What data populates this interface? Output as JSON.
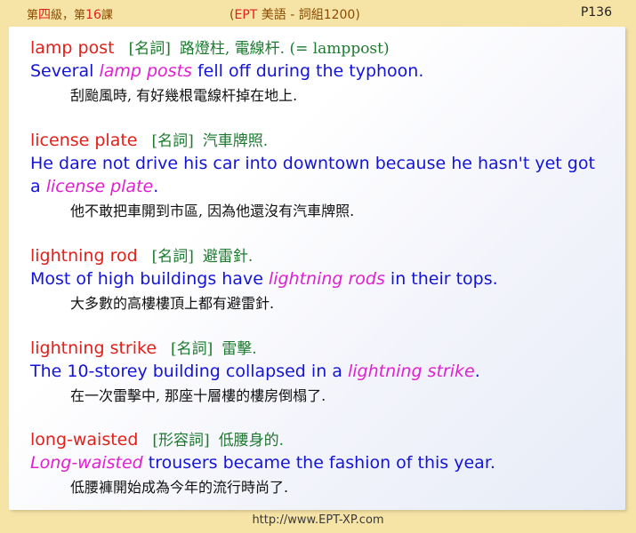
{
  "header": {
    "lesson_prefix": "第",
    "level_char": "四",
    "level_suffix": "級",
    "sep": "，",
    "lesson_pre": "第",
    "lesson_num": "16",
    "lesson_post": "課",
    "title_open": "(",
    "title_ept": "EPT",
    "title_rest": " 美語 - 詞組1200)",
    "page": "P136"
  },
  "entries": [
    {
      "term": "lamp post",
      "pos": "[名詞]",
      "definition": "路燈柱, 電線杆. (= lamppost)",
      "sentence_before": "Several ",
      "sentence_highlight": "lamp posts",
      "sentence_after": " fell off during the typhoon.",
      "translation": "刮颱風時, 有好幾根電線杆掉在地上."
    },
    {
      "term": "license plate",
      "pos": "[名詞]",
      "definition": "汽車牌照.",
      "sentence_before": "He dare not drive his car into downtown because he hasn't yet got a ",
      "sentence_highlight": "license plate",
      "sentence_after": ".",
      "translation": "他不敢把車開到市區, 因為他還沒有汽車牌照."
    },
    {
      "term": "lightning rod",
      "pos": "[名詞]",
      "definition": "避雷針.",
      "sentence_before": "Most of high buildings have ",
      "sentence_highlight": "lightning rods",
      "sentence_after": " in their tops.",
      "translation": "大多數的高樓樓頂上都有避雷針."
    },
    {
      "term": "lightning strike",
      "pos": "[名詞]",
      "definition": "雷擊.",
      "sentence_before": "The 10-storey building collapsed in a ",
      "sentence_highlight": "lightning strike",
      "sentence_after": ".",
      "translation": "在一次雷擊中, 那座十層樓的樓房倒榻了."
    },
    {
      "term": "long-waisted",
      "pos": "[形容詞]",
      "definition": "低腰身的.",
      "sentence_before": "",
      "sentence_highlight": "Long-waisted",
      "sentence_after": " trousers became the fashion of this year.",
      "translation": "低腰褲開始成為今年的流行時尚了."
    }
  ],
  "footer": {
    "url": "http://www.EPT-XP.com"
  },
  "colors": {
    "background": "#f6e3a6",
    "term": "#e0201a",
    "pos": "#1b7a2e",
    "sentence": "#1414d8",
    "highlight": "#e020d0"
  }
}
